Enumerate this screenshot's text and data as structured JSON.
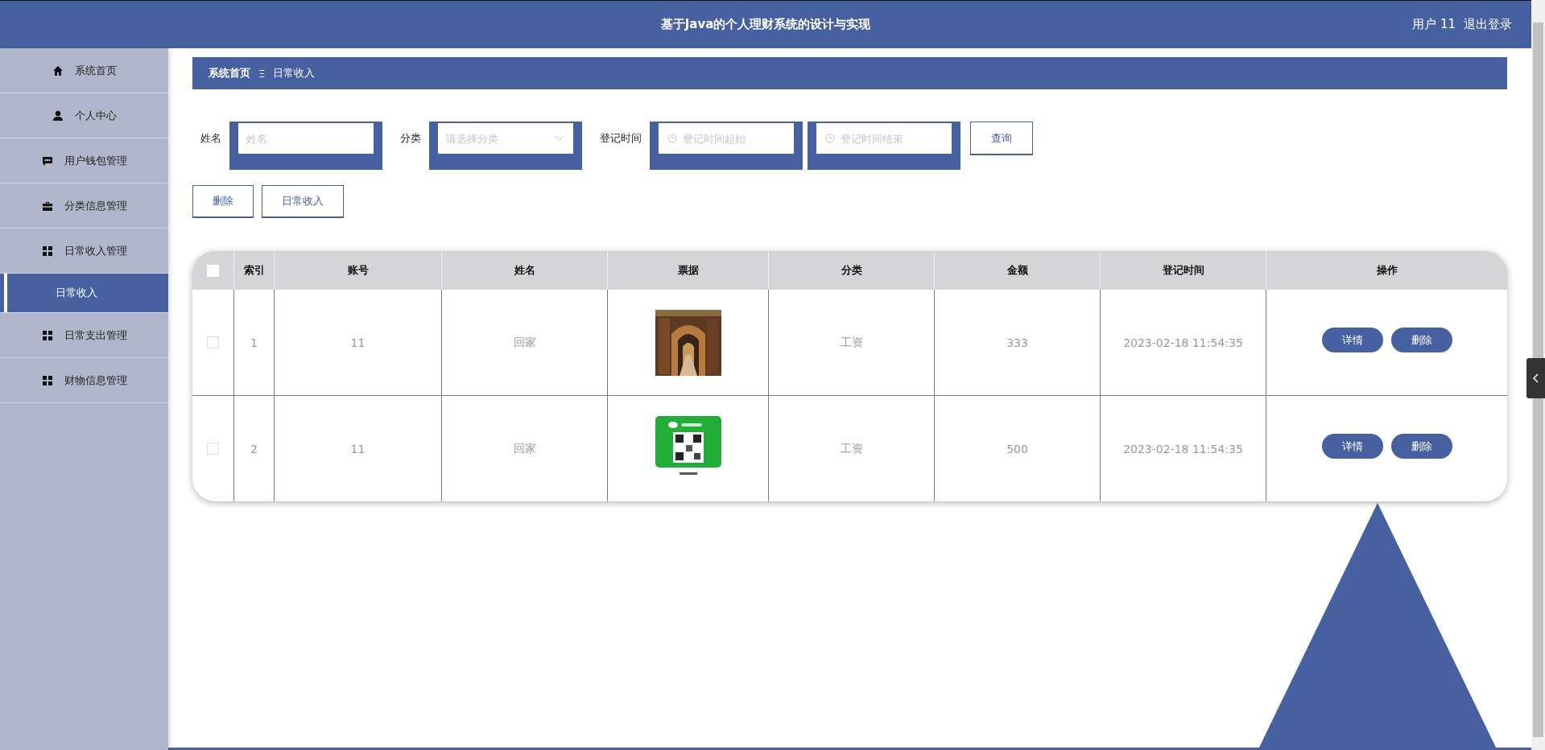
{
  "header": {
    "title": "基于Java的个人理财系统的设计与实现",
    "user": "用户 11",
    "logout": "退出登录"
  },
  "sidebar": {
    "items": [
      {
        "label": "系统首页",
        "selected": false
      },
      {
        "label": "个人中心",
        "selected": false
      },
      {
        "label": "用户钱包管理",
        "selected": false
      },
      {
        "label": "分类信息管理",
        "selected": false
      },
      {
        "label": "日常收入管理",
        "selected": false,
        "expanded": true,
        "children": [
          {
            "label": "日常收入",
            "selected": true
          }
        ]
      },
      {
        "label": "日常支出管理",
        "selected": false
      },
      {
        "label": "财物信息管理",
        "selected": false
      }
    ]
  },
  "breadcrumb": {
    "home": "系统首页",
    "separator": "Ξ",
    "current": "日常收入"
  },
  "search": {
    "fields": [
      {
        "label": "姓名",
        "kind": "text",
        "placeholder": "姓名"
      },
      {
        "label": "分类",
        "kind": "select",
        "placeholder": "请选择分类"
      },
      {
        "label": "登记时间",
        "kind": "date",
        "placeholder": "登记时间起始"
      },
      {
        "kind": "date",
        "placeholder": "登记时间结束"
      }
    ],
    "button": "查询"
  },
  "actions": [
    "删除",
    "日常收入"
  ],
  "table": {
    "header_checkbox": {
      "checked": false
    },
    "columns": [
      "索引",
      "账号",
      "姓名",
      "票据",
      "分类",
      "金额",
      "登记时间",
      "操作"
    ],
    "rows": [
      {
        "checked": false,
        "index": "1",
        "account": "11",
        "name": "回家",
        "category": "工资",
        "amount": "333",
        "time": "2023-02-18 11:54:35",
        "buttons": [
          "详情",
          "删除"
        ]
      },
      {
        "checked": false,
        "index": "2",
        "account": "11",
        "name": "回家",
        "category": "工资",
        "amount": "500",
        "time": "2023-02-18 11:54:35",
        "buttons": [
          "详情",
          "删除"
        ]
      }
    ]
  }
}
